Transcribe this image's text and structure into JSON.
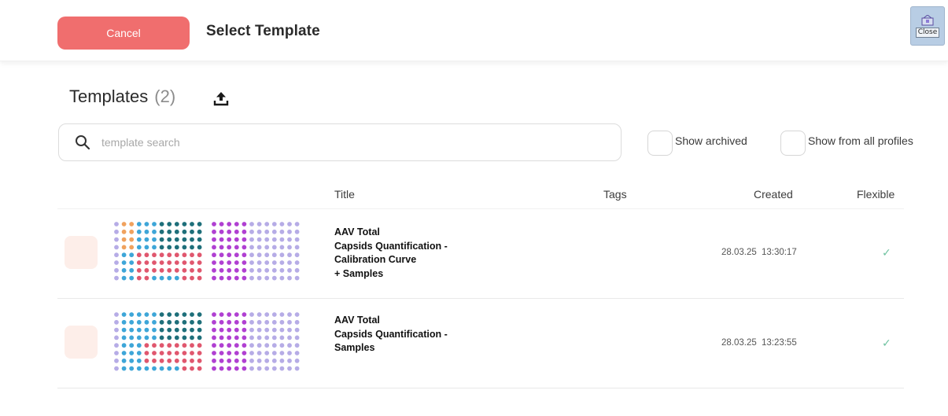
{
  "header": {
    "cancel_label": "Cancel",
    "title": "Select Template",
    "close_label": "Close"
  },
  "templates": {
    "heading": "Templates",
    "count": "(2)"
  },
  "search": {
    "placeholder": "template search",
    "value": ""
  },
  "filters": {
    "show_archived": "Show archived",
    "show_all_profiles": "Show from all profiles"
  },
  "table": {
    "columns": {
      "title": "Title",
      "tags": "Tags",
      "created": "Created",
      "flexible": "Flexible"
    },
    "rows": [
      {
        "title": "AAV  Total\nCapsids Quantification -\nCalibration Curve\n+ Samples",
        "tags": "",
        "created": "28.03.25   13:30:17",
        "flexible": "✓"
      },
      {
        "title": "AAV  Total\nCapsids Quantification -\nSamples",
        "tags": "",
        "created": "28.03.25   13:23:55",
        "flexible": "✓"
      }
    ]
  },
  "colors": {
    "accent": "#f06e6e",
    "check": "#6fc2a0",
    "plate": {
      "lavender": "#b6ace6",
      "orange": "#f0a25e",
      "blue": "#3ea6d8",
      "teal": "#1e6f7a",
      "red": "#e0576e",
      "magenta": "#b040d2"
    }
  }
}
